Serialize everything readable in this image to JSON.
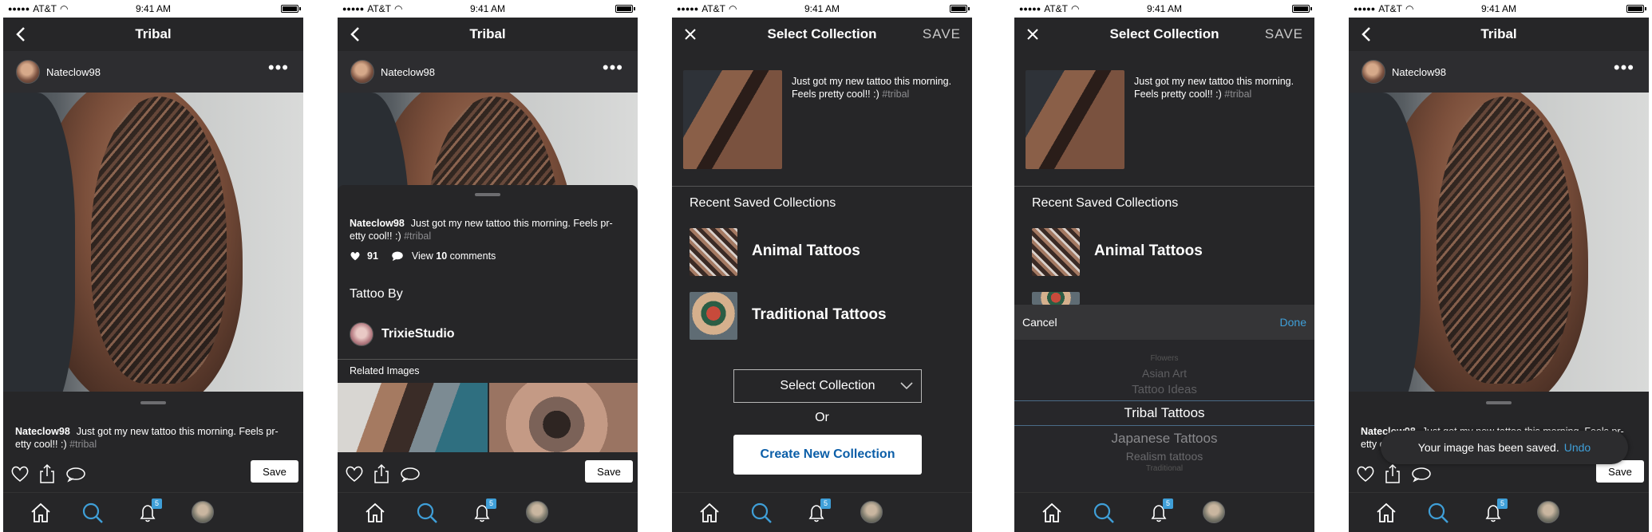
{
  "status": {
    "carrier": "AT&T",
    "time": "9:41 AM"
  },
  "post": {
    "title": "Tribal",
    "username": "Nateclow98",
    "caption": "Just got my  new tattoo this morning. Feels pretty cool!! :)",
    "caption_wrap_1": "Just got my  new tattoo this morning. Feels pr-",
    "caption_wrap_2": "etty cool!! :)",
    "caption_short_1": "Just got my  new tattoo this morning.",
    "caption_short_2": "Feels pretty cool!! :)",
    "hashtag": "#tribal",
    "likes": "91",
    "comments_prefix": "View",
    "comments_count": "10",
    "comments_suffix": "comments",
    "save_label": "Save"
  },
  "details": {
    "tattoo_by_label": "Tattoo By",
    "artist": "TrixieStudio",
    "related_label": "Related Images"
  },
  "collection": {
    "title": "Select Collection",
    "save": "SAVE",
    "recent_label": "Recent Saved Collections",
    "items": [
      "Animal Tattoos",
      "Traditional Tattoos"
    ],
    "select_label": "Select Collection",
    "or_label": "Or",
    "create_label": "Create New Collection"
  },
  "picker": {
    "cancel": "Cancel",
    "done": "Done",
    "options": [
      "Flowers",
      "Asian Art",
      "Tattoo Ideas",
      "Tribal Tattoos",
      "Japanese Tattoos",
      "Realism tattoos",
      "Traditional"
    ],
    "selected_index": 3
  },
  "toast": {
    "message": "Your  image has been saved.",
    "action": "Undo"
  },
  "tabbar": {
    "notification_count": "5"
  },
  "colors": {
    "accent": "#3f9fd8",
    "background": "#262628",
    "link": "#0b5ea8"
  }
}
